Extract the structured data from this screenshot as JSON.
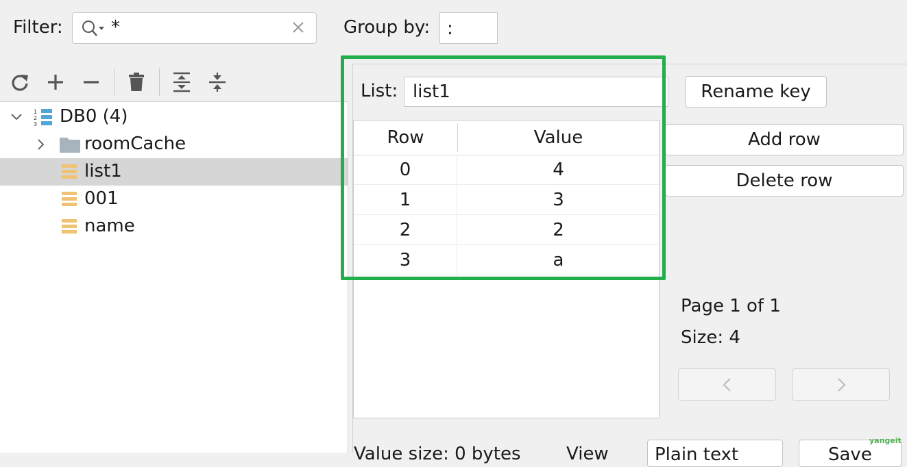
{
  "filter": {
    "label": "Filter:",
    "value": "*"
  },
  "group_by": {
    "label": "Group by:",
    "value": ":"
  },
  "toolbar": {
    "icons": [
      "reload-icon",
      "add-icon",
      "remove-icon",
      "delete-icon",
      "expand-all-icon",
      "collapse-all-icon"
    ]
  },
  "tree": {
    "db": {
      "label": "DB0 (4)"
    },
    "items": [
      {
        "label": "roomCache",
        "type": "folder"
      },
      {
        "label": "list1",
        "type": "list",
        "selected": true
      },
      {
        "label": "001",
        "type": "list"
      },
      {
        "label": "name",
        "type": "list"
      }
    ]
  },
  "editor": {
    "key_type_label": "List:",
    "key_name": "list1",
    "rename_label": "Rename key",
    "add_row_label": "Add row",
    "delete_row_label": "Delete row",
    "table": {
      "columns": [
        "Row",
        "Value"
      ],
      "rows": [
        {
          "row": "0",
          "value": "4"
        },
        {
          "row": "1",
          "value": "3"
        },
        {
          "row": "2",
          "value": "2"
        },
        {
          "row": "3",
          "value": "a"
        }
      ]
    },
    "page_info": "Page 1 of 1",
    "size_info": "Size: 4",
    "prev_label": "‹",
    "next_label": "›"
  },
  "bottom": {
    "value_size_text": "Value size: 0 bytes",
    "view_label": "View",
    "view_value": "Plain text",
    "save_label": "Save"
  },
  "watermark": "yangeit",
  "highlight_color": "#22ae4b"
}
